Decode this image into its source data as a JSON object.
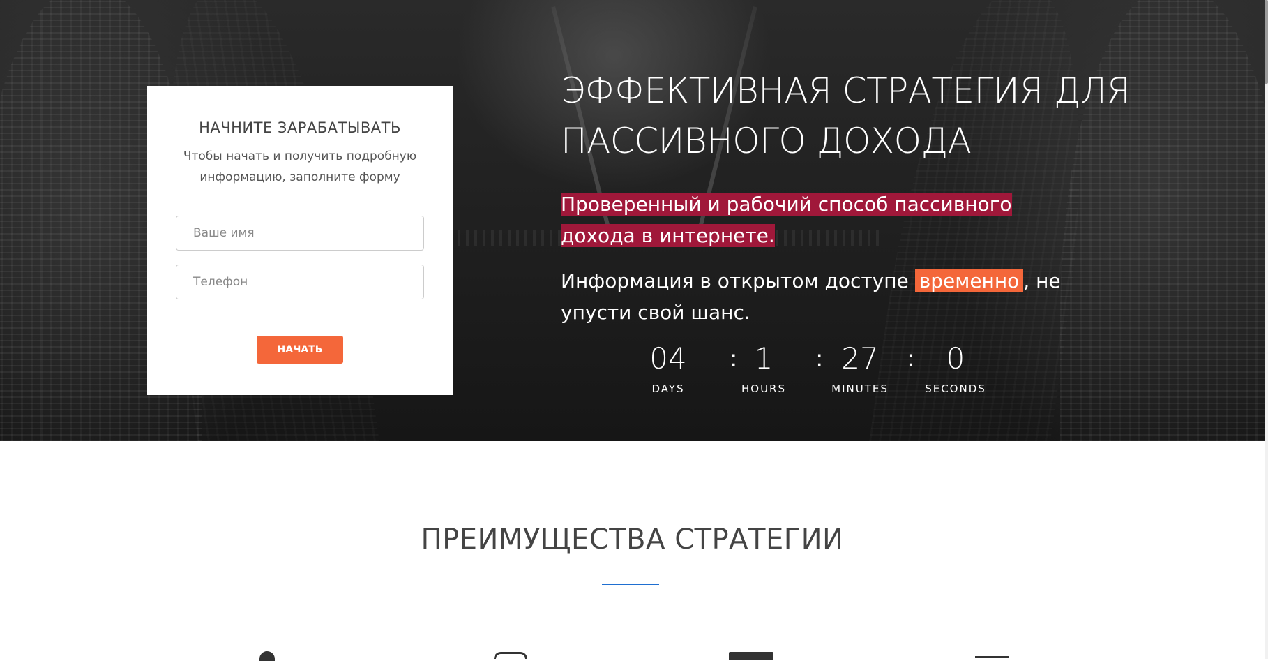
{
  "form": {
    "title": "НАЧНИТЕ ЗАРАБАТЫВАТЬ",
    "subtitle": "Чтобы начать и получить подробную информацию, заполните форму",
    "name_placeholder": "Ваше имя",
    "name_value": "",
    "phone_placeholder": "Телефон",
    "phone_value": "",
    "submit_label": "НАЧАТЬ"
  },
  "hero": {
    "title": "ЭФФЕКТИВНАЯ СТРАТЕГИЯ ДЛЯ ПАССИВНОГО ДОХОДА",
    "lead": "Проверенный и рабочий способ пассивного дохода в интернете.",
    "info_before": "Информация в открытом доступе ",
    "info_highlight": "временно",
    "info_after": ", не упусти свой шанс."
  },
  "countdown": {
    "days": "04",
    "days_label": "DAYS",
    "hours": "1",
    "hours_label": "HOURS",
    "minutes": "27",
    "minutes_label": "MINUTES",
    "seconds": "0",
    "seconds_label": "SECONDS",
    "separator": ":"
  },
  "advantages": {
    "title": "ПРЕИМУЩЕСТВА СТРАТЕГИИ",
    "icons": [
      "person-icon",
      "clock-icon",
      "monitor-icon",
      "document-icon"
    ]
  },
  "colors": {
    "accent_orange": "#f4673a",
    "highlight_red": "#a0183a",
    "divider_blue": "#1f6fd1",
    "card_bg": "#ffffff"
  }
}
